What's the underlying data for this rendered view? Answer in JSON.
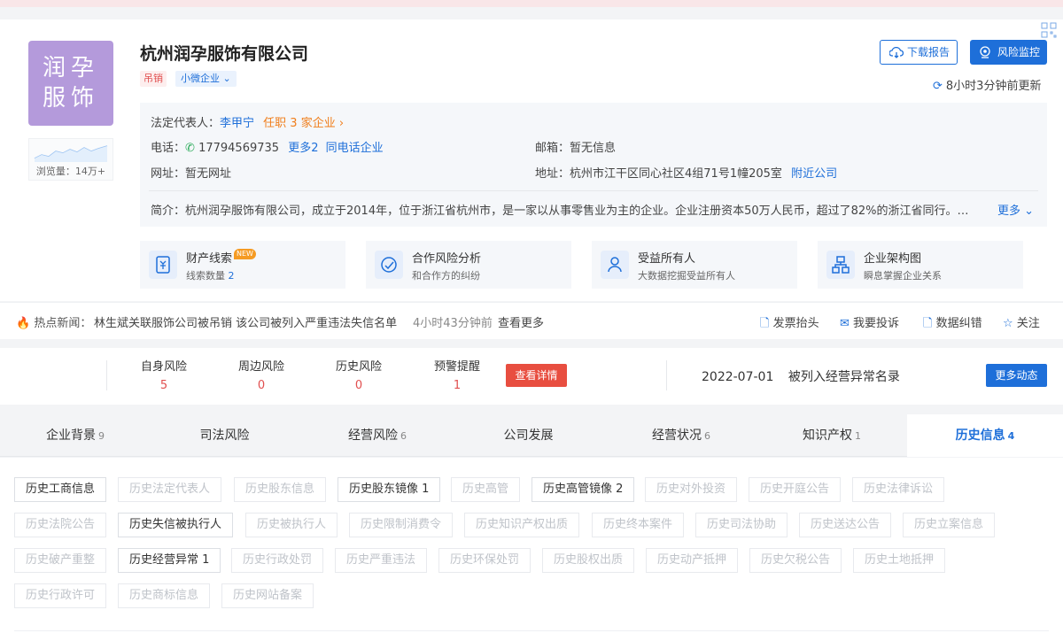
{
  "company": {
    "logo_line1": "润孕",
    "logo_line2": "服饰",
    "name": "杭州润孕服饰有限公司",
    "status_tag": "吊销",
    "scale_tag": "小微企业",
    "views_label": "浏览量：14万+"
  },
  "actions": {
    "download_report": "下载报告",
    "risk_monitor": "风险监控",
    "updated": "8小时3分钟前更新"
  },
  "info": {
    "legal_rep_label": "法定代表人：",
    "legal_rep_name": "李甲宁",
    "legal_rep_positions": "任职 3 家企业",
    "phone_label": "电话：",
    "phone": "17794569735",
    "phone_more": "更多2",
    "phone_same": "同电话企业",
    "email_label": "邮箱：",
    "email": "暂无信息",
    "website_label": "网址：",
    "website": "暂无网址",
    "address_label": "地址：",
    "address": "杭州市江干区同心社区4组71号1幢205室",
    "address_nearby": "附近公司",
    "intro_label": "简介：",
    "intro": "杭州润孕服饰有限公司，成立于2014年，位于浙江省杭州市，是一家以从事零售业为主的企业。企业注册资本50万人民币，超过了82%的浙江省同行。…",
    "intro_more": "更多"
  },
  "features": [
    {
      "title": "财产线索",
      "badge": "NEW",
      "sub_prefix": "线索数量 ",
      "sub_count": "2"
    },
    {
      "title": "合作风险分析",
      "sub": "和合作方的纠纷"
    },
    {
      "title": "受益所有人",
      "sub": "大数据挖掘受益所有人"
    },
    {
      "title": "企业架构图",
      "sub": "瞬息掌握企业关系"
    }
  ],
  "news": {
    "label": "热点新闻：",
    "headline": "林生斌关联服饰公司被吊销 该公司被列入严重违法失信名单",
    "time": "4小时43分钟前",
    "see_more": "查看更多",
    "links": [
      "发票抬头",
      "我要投诉",
      "数据纠错",
      "关注"
    ]
  },
  "risk": {
    "items": [
      {
        "label": "自身风险",
        "value": "5"
      },
      {
        "label": "周边风险",
        "value": "0"
      },
      {
        "label": "历史风险",
        "value": "0"
      },
      {
        "label": "预警提醒",
        "value": "1"
      }
    ],
    "detail_button": "查看详情",
    "event_date": "2022-07-01",
    "event_text": "被列入经营异常名录",
    "more_button": "更多动态"
  },
  "tabs": [
    {
      "label": "企业背景",
      "count": "9"
    },
    {
      "label": "司法风险",
      "count": ""
    },
    {
      "label": "经营风险",
      "count": "6"
    },
    {
      "label": "公司发展",
      "count": ""
    },
    {
      "label": "经营状况",
      "count": "6"
    },
    {
      "label": "知识产权",
      "count": "1"
    },
    {
      "label": "历史信息",
      "count": "4"
    }
  ],
  "history_chips": [
    "历史工商信息",
    "历史法定代表人",
    "历史股东信息",
    "历史股东镜像 1",
    "历史高管",
    "历史高管镜像 2",
    "历史对外投资",
    "历史开庭公告",
    "历史法律诉讼",
    "历史法院公告",
    "历史失信被执行人",
    "历史被执行人",
    "历史限制消费令",
    "历史知识产权出质",
    "历史终本案件",
    "历史司法协助",
    "历史送达公告",
    "历史立案信息",
    "历史破产重整",
    "历史经营异常 1",
    "历史行政处罚",
    "历史严重违法",
    "历史环保处罚",
    "历史股权出质",
    "历史动产抵押",
    "历史欠税公告",
    "历史土地抵押",
    "历史行政许可",
    "历史商标信息",
    "历史网站备案"
  ],
  "colors": {
    "accent": "#1e6fd9",
    "logo_bg": "#b49adb",
    "danger": "#e84e40",
    "warning": "#f07e1b"
  }
}
